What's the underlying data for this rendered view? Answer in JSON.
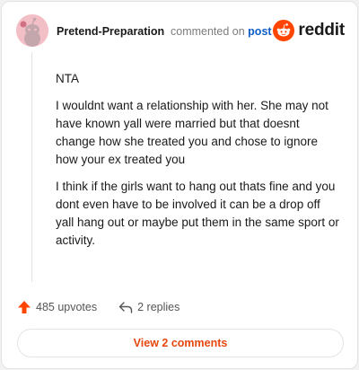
{
  "comment": {
    "author": "Pretend-Preparation",
    "action_text": "commented on",
    "target_link": "post",
    "brand": "reddit",
    "paragraphs": [
      "NTA",
      "I wouldnt want a relationship with her. She may not have known yall were married but that doesnt change how she treated you and chose to ignore how your ex treated you",
      "I think if the girls want to hang out thats fine and you dont even have to be involved it can be a drop off yall hang out or maybe put them in the same sport or activity."
    ],
    "upvotes_label": "485 upvotes",
    "replies_label": "2 replies",
    "view_comments_label": "View 2 comments"
  },
  "colors": {
    "accent": "#e5470e",
    "reddit_orange": "#ff4500",
    "link_blue": "#0f5cc7",
    "avatar_bg": "#f3bfc6"
  },
  "icons": {
    "avatar": "snoo-avatar-icon",
    "brand": "reddit-logo-icon",
    "upvote": "upvote-arrow-icon",
    "reply": "reply-arrow-icon"
  }
}
